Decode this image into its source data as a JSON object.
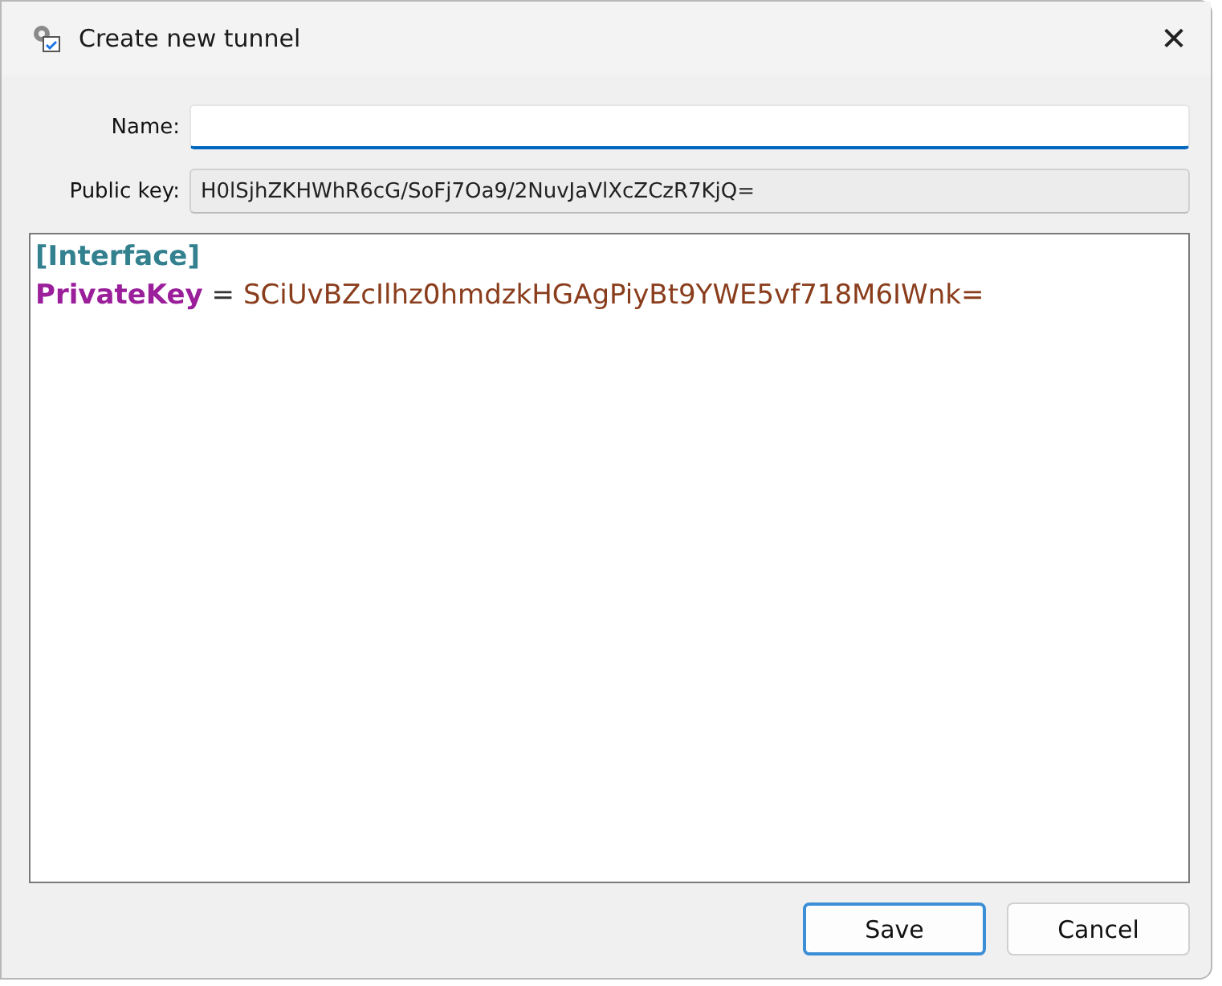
{
  "window": {
    "title": "Create new tunnel",
    "close": "✕"
  },
  "fields": [
    {
      "label": "Name:",
      "focused": true,
      "readonly": false
    },
    {
      "label": "Public key:",
      "value": "H0lSjhZKHWhR6cG/SoFj7Oa9/2NuvJaVlXcZCzR7KjQ=",
      "focused": false,
      "readonly": true
    }
  ],
  "editor": {
    "lines": [
      {
        "kind": "section",
        "text": "[Interface]"
      },
      {
        "kind": "pair",
        "key": "PrivateKey",
        "separator": "=",
        "value": "SCiUvBZcIlhz0hmdzkHGAgPiyBt9YWE5vf718M6IWnk="
      }
    ]
  },
  "buttons": [
    {
      "label": "Save",
      "default": true
    },
    {
      "label": "Cancel",
      "default": false
    }
  ]
}
